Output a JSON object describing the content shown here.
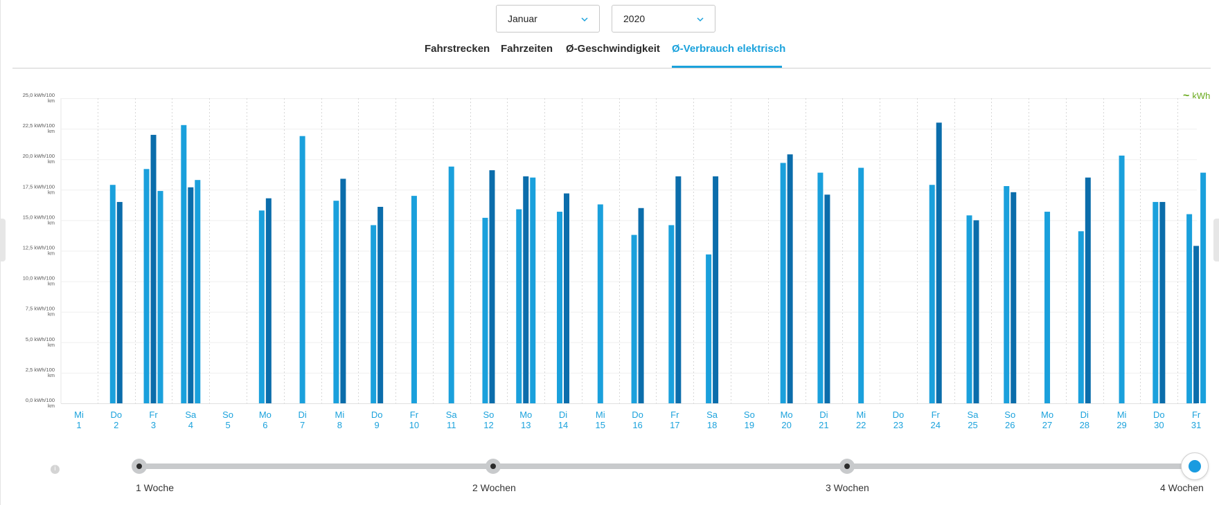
{
  "filters": {
    "month": "Januar",
    "year": "2020"
  },
  "tabs": [
    {
      "label": "Fahrstrecken",
      "active": false
    },
    {
      "label": "Fahrzeiten",
      "active": false
    },
    {
      "label": "Ø-Geschwindigkeit",
      "active": false
    },
    {
      "label": "Ø-Verbrauch elektrisch",
      "active": true
    }
  ],
  "legend": {
    "label": "kWh",
    "icon": "wave-icon",
    "color": "#6aaa1e"
  },
  "colors": {
    "accent": "#1ba2dc",
    "bar_light": "#1aa0dc",
    "bar_dark": "#0b6dab",
    "day_label": "#1ba2dc"
  },
  "slider": {
    "stops": [
      {
        "label": "1 Woche",
        "selected": false
      },
      {
        "label": "2 Wochen",
        "selected": false
      },
      {
        "label": "3 Wochen",
        "selected": false
      },
      {
        "label": "4 Wochen",
        "selected": true
      }
    ],
    "info": "i"
  },
  "chart_data": {
    "type": "bar",
    "ylim": [
      0,
      25
    ],
    "yticks": [
      {
        "value": 0,
        "line1": "0,0 kWh/100",
        "line2": "km"
      },
      {
        "value": 2.5,
        "line1": "2,5 kWh/100",
        "line2": "km"
      },
      {
        "value": 5,
        "line1": "5,0 kWh/100",
        "line2": "km"
      },
      {
        "value": 7.5,
        "line1": "7,5 kWh/100",
        "line2": "km"
      },
      {
        "value": 10,
        "line1": "10,0 kWh/100",
        "line2": "km"
      },
      {
        "value": 12.5,
        "line1": "12,5 kWh/100",
        "line2": "km"
      },
      {
        "value": 15,
        "line1": "15,0 kWh/100",
        "line2": "km"
      },
      {
        "value": 17.5,
        "line1": "17,5 kWh/100",
        "line2": "km"
      },
      {
        "value": 20,
        "line1": "20,0 kWh/100",
        "line2": "km"
      },
      {
        "value": 22.5,
        "line1": "22,5 kWh/100",
        "line2": "km"
      },
      {
        "value": 25,
        "line1": "25,0 kWh/100",
        "line2": "km"
      }
    ],
    "days": [
      {
        "weekday": "Mi",
        "day": "1",
        "values": []
      },
      {
        "weekday": "Do",
        "day": "2",
        "values": [
          17.9,
          16.5
        ]
      },
      {
        "weekday": "Fr",
        "day": "3",
        "values": [
          19.2,
          22.0,
          17.4
        ]
      },
      {
        "weekday": "Sa",
        "day": "4",
        "values": [
          22.8,
          17.7,
          18.3
        ]
      },
      {
        "weekday": "So",
        "day": "5",
        "values": []
      },
      {
        "weekday": "Mo",
        "day": "6",
        "values": [
          15.8,
          16.8
        ]
      },
      {
        "weekday": "Di",
        "day": "7",
        "values": [
          21.9
        ]
      },
      {
        "weekday": "Mi",
        "day": "8",
        "values": [
          16.6,
          18.4
        ]
      },
      {
        "weekday": "Do",
        "day": "9",
        "values": [
          14.6,
          16.1
        ]
      },
      {
        "weekday": "Fr",
        "day": "10",
        "values": [
          17.0
        ]
      },
      {
        "weekday": "Sa",
        "day": "11",
        "values": [
          19.4
        ]
      },
      {
        "weekday": "So",
        "day": "12",
        "values": [
          15.2,
          19.1
        ]
      },
      {
        "weekday": "Mo",
        "day": "13",
        "values": [
          15.9,
          18.6,
          18.5
        ]
      },
      {
        "weekday": "Di",
        "day": "14",
        "values": [
          15.7,
          17.2
        ]
      },
      {
        "weekday": "Mi",
        "day": "15",
        "values": [
          16.3
        ]
      },
      {
        "weekday": "Do",
        "day": "16",
        "values": [
          13.8,
          16.0
        ]
      },
      {
        "weekday": "Fr",
        "day": "17",
        "values": [
          14.6,
          18.6
        ]
      },
      {
        "weekday": "Sa",
        "day": "18",
        "values": [
          12.2,
          18.6
        ]
      },
      {
        "weekday": "So",
        "day": "19",
        "values": []
      },
      {
        "weekday": "Mo",
        "day": "20",
        "values": [
          19.7,
          20.4
        ]
      },
      {
        "weekday": "Di",
        "day": "21",
        "values": [
          18.9,
          17.1
        ]
      },
      {
        "weekday": "Mi",
        "day": "22",
        "values": [
          19.3
        ]
      },
      {
        "weekday": "Do",
        "day": "23",
        "values": []
      },
      {
        "weekday": "Fr",
        "day": "24",
        "values": [
          17.9,
          23.0
        ]
      },
      {
        "weekday": "Sa",
        "day": "25",
        "values": [
          15.4,
          15.0
        ]
      },
      {
        "weekday": "So",
        "day": "26",
        "values": [
          17.8,
          17.3
        ]
      },
      {
        "weekday": "Mo",
        "day": "27",
        "values": [
          15.7
        ]
      },
      {
        "weekday": "Di",
        "day": "28",
        "values": [
          14.1,
          18.5
        ]
      },
      {
        "weekday": "Mi",
        "day": "29",
        "values": [
          20.3
        ]
      },
      {
        "weekday": "Do",
        "day": "30",
        "values": [
          16.5,
          16.5
        ]
      },
      {
        "weekday": "Fr",
        "day": "31",
        "values": [
          15.5,
          12.9,
          18.9
        ]
      }
    ]
  }
}
